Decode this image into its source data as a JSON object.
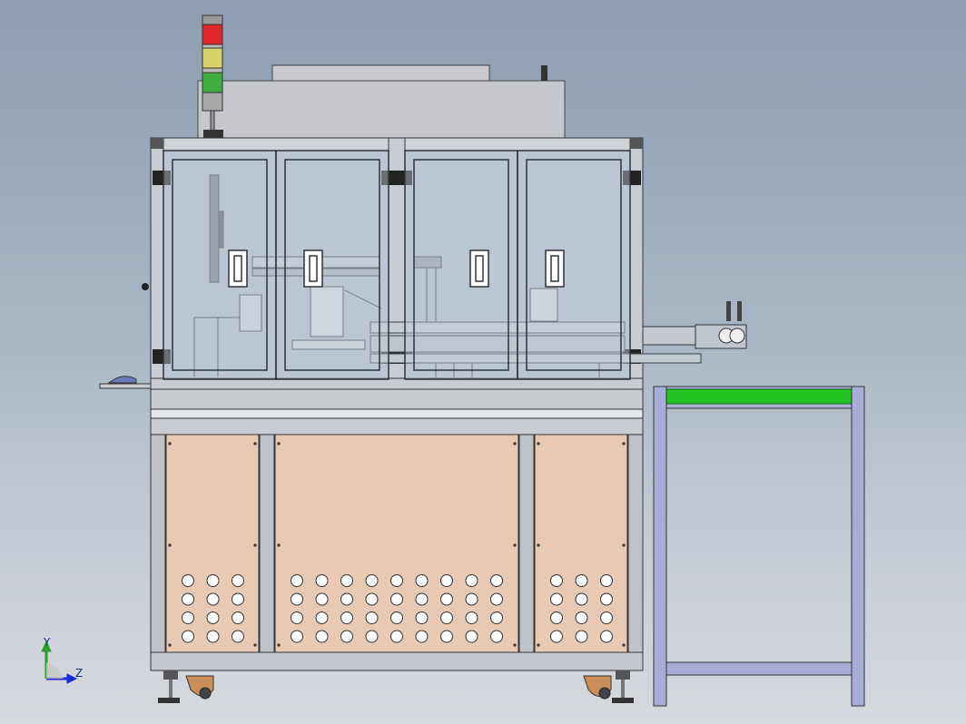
{
  "viewport": {
    "background_top": "#8d9db2",
    "background_bottom": "#d6d9de"
  },
  "triad": {
    "y_label": "Y",
    "z_label": "Z",
    "y_color": "#2e9b2e",
    "z_color": "#1a2bd8"
  },
  "signal_tower": {
    "lamps": [
      "red",
      "yellow",
      "green"
    ],
    "colors": [
      "#e0262a",
      "#d8d46a",
      "#3fae3f"
    ]
  },
  "machine": {
    "frame_color": "#c9cdd3",
    "glass_color": "#b8c3d1",
    "panel_color": "#e8c9b4",
    "vent_hole_rows": 4
  },
  "conveyor": {
    "belt_color": "#22c222",
    "stand_color": "#a9acd6"
  }
}
